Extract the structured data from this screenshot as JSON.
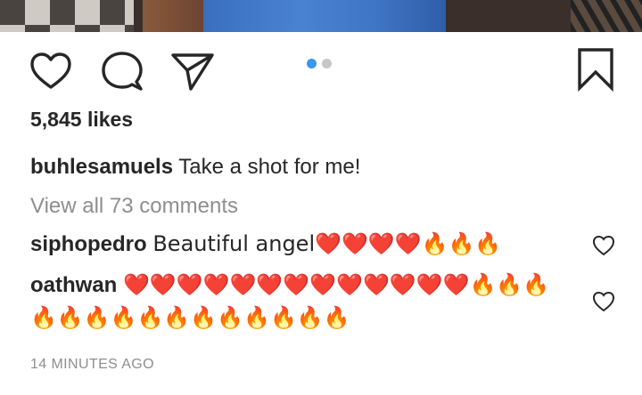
{
  "post": {
    "likes_text": "5,845 likes",
    "caption": {
      "username": "buhlesamuels",
      "text": "Take a shot for me!"
    },
    "view_all_comments": "View all 73 comments",
    "comments": [
      {
        "username": "siphopedro",
        "text": "Beautiful angel❤️❤️❤️❤️🔥🔥🔥"
      },
      {
        "username": "oathwan",
        "text": "❤️❤️❤️❤️❤️❤️❤️❤️❤️❤️❤️❤️❤️🔥🔥🔥🔥🔥🔥🔥🔥🔥🔥🔥🔥🔥🔥🔥"
      }
    ],
    "timestamp": "14 MINUTES AGO"
  },
  "carousel": {
    "count": 2,
    "active_index": 0
  },
  "icons": {
    "like": "heart-outline-icon",
    "comment": "comment-bubble-icon",
    "share": "paper-plane-icon",
    "save": "bookmark-outline-icon",
    "comment_like": "small-heart-outline-icon"
  },
  "colors": {
    "text": "#262626",
    "secondary": "#8e8e8e",
    "dot_active": "#3897f0",
    "dot_inactive": "#c7c7c7"
  }
}
